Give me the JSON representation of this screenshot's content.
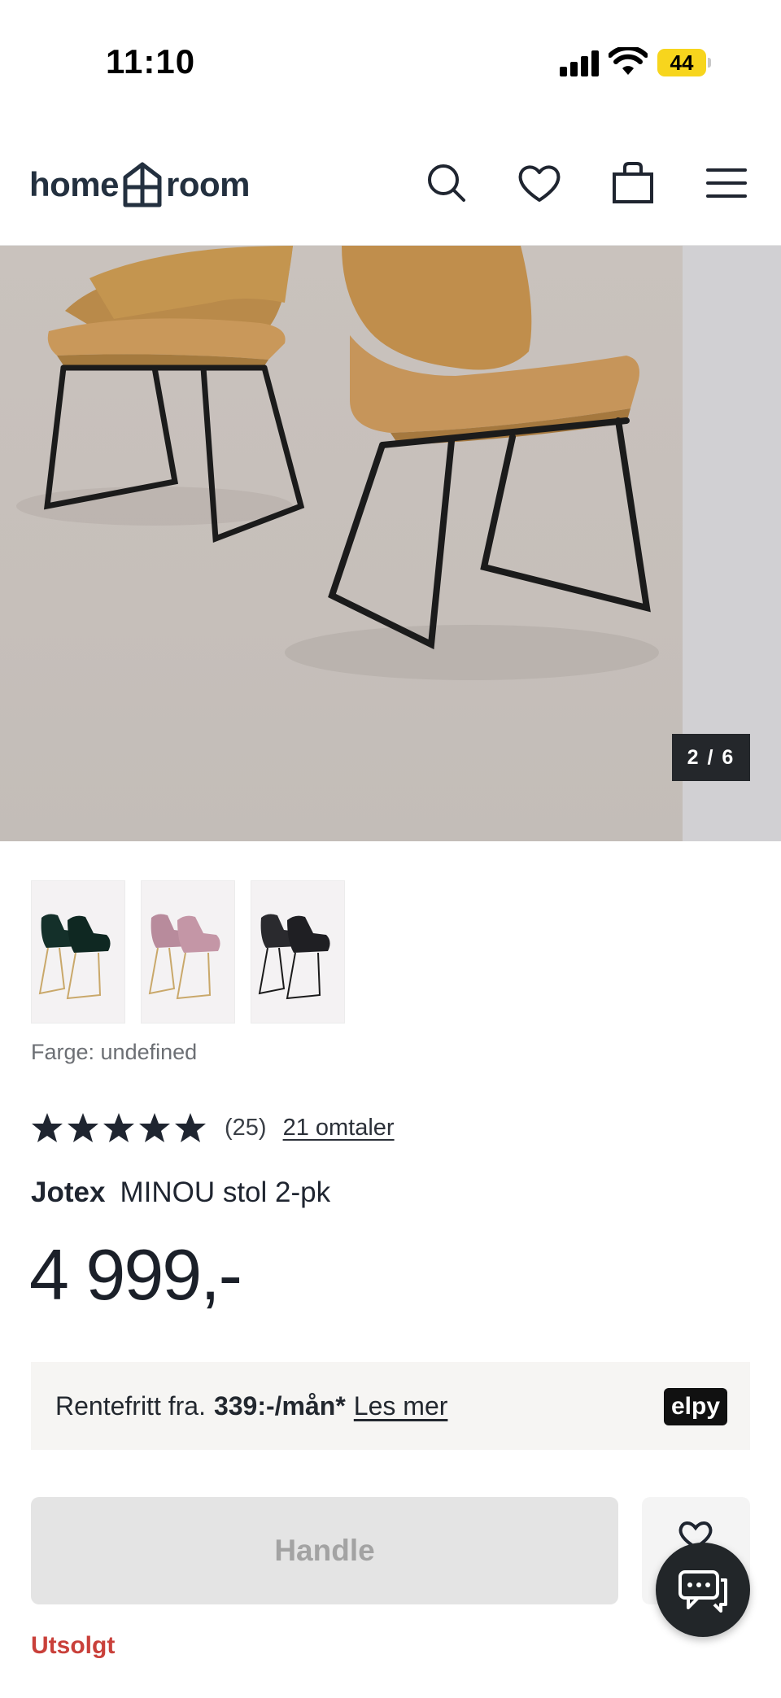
{
  "status_bar": {
    "time": "11:10",
    "battery": "44"
  },
  "header": {
    "logo_left": "home",
    "logo_right": "room",
    "icons": [
      "search-icon",
      "heart-icon",
      "bag-icon",
      "menu-icon"
    ]
  },
  "gallery": {
    "counter": "2 / 6"
  },
  "variants": {
    "swatches": [
      "dark green",
      "pink",
      "black"
    ],
    "color_label": "Farge: undefined"
  },
  "rating": {
    "stars": 5,
    "count": "(25)",
    "reviews_link": "21 omtaler"
  },
  "product": {
    "brand": "Jotex",
    "name": "MINOU stol 2-pk",
    "price": "4 999,-"
  },
  "financing": {
    "prefix": "Rentefritt fra.",
    "amount": "339:-/mån*",
    "read_more": "Les mer",
    "provider": "elpy"
  },
  "buy": {
    "button_label": "Handle",
    "status": "Utsolgt"
  },
  "colors": {
    "accent_soldout": "#c9403a",
    "logo": "#23303f",
    "buy_disabled_bg": "#e4e4e4"
  }
}
